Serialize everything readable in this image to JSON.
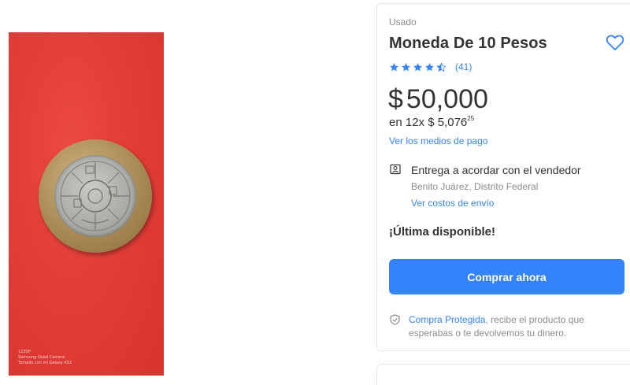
{
  "photo": {
    "watermark_lines": [
      "123SP",
      "Samsung Quad Camera",
      "Tomado con mi Galaxy A52"
    ]
  },
  "product": {
    "condition": "Usado",
    "title": "Moneda De 10 Pesos",
    "rating_value": 4.5,
    "rating_count": "(41)",
    "price_symbol": "$",
    "price_amount": "50,000",
    "installments_prefix": "en 12x $ 5,076",
    "installments_cents": "25",
    "payment_link": "Ver los medios de pago"
  },
  "delivery": {
    "icon": "store-pickup-icon",
    "title": "Entrega a acordar con el vendedor",
    "location": "Benito Juárez, Distrito Federal",
    "shipping_link": "Ver costos de envío"
  },
  "stock_text": "¡Última disponible!",
  "buy_button_label": "Comprar ahora",
  "protection": {
    "icon": "shield-check-icon",
    "link": "Compra Protegida",
    "text": ", recibe el producto que esperabas o te devolvemos tu dinero."
  },
  "colors": {
    "accent": "#3483fa",
    "photo_background": "#e23d37",
    "text_primary": "#333333",
    "text_secondary": "#8c8c8c"
  }
}
